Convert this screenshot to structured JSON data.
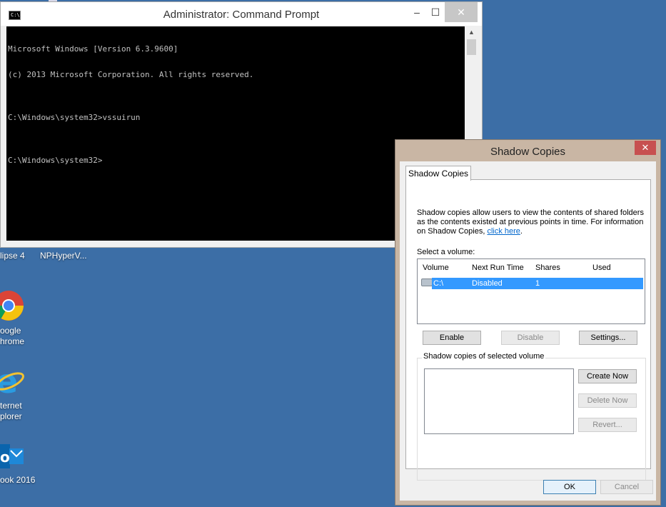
{
  "cmd": {
    "title": "Administrator: Command Prompt",
    "icon_text": "C:\\",
    "lines": [
      "Microsoft Windows [Version 6.3.9600]",
      "(c) 2013 Microsoft Corporation. All rights reserved.",
      "",
      "C:\\Windows\\system32>vssuirun",
      "",
      "C:\\Windows\\system32>"
    ],
    "min": "–",
    "max": "☐",
    "close": "✕"
  },
  "desktop": {
    "items": [
      {
        "label": "lipse 4"
      },
      {
        "label": "NPHyperV..."
      },
      {
        "label1": "oogle",
        "label2": "hrome"
      },
      {
        "label1": "ternet",
        "label2": "plorer"
      },
      {
        "label": "ook 2016"
      }
    ]
  },
  "dialog": {
    "title": "Shadow Copies",
    "close": "✕",
    "tab": "Shadow Copies",
    "description": "Shadow copies allow users to view the contents of shared folders as the contents existed at previous points in time. For information on Shadow Copies, ",
    "link": "click here",
    "link_suffix": ".",
    "select_volume": "Select a volume:",
    "columns": [
      "Volume",
      "Next Run Time",
      "Shares",
      "Used"
    ],
    "rows": [
      {
        "volume": "C:\\",
        "next_run": "Disabled",
        "shares": "1",
        "used": ""
      }
    ],
    "buttons": {
      "enable": "Enable",
      "disable": "Disable",
      "settings": "Settings...",
      "create_now": "Create Now",
      "delete_now": "Delete Now",
      "revert": "Revert...",
      "ok": "OK",
      "cancel": "Cancel"
    },
    "group_label": "Shadow copies of selected volume"
  },
  "colors": {
    "desktop": "#3c6ea6",
    "selection": "#3399ff",
    "dialog_frame": "#c9b6a4",
    "close_red": "#c75050"
  }
}
